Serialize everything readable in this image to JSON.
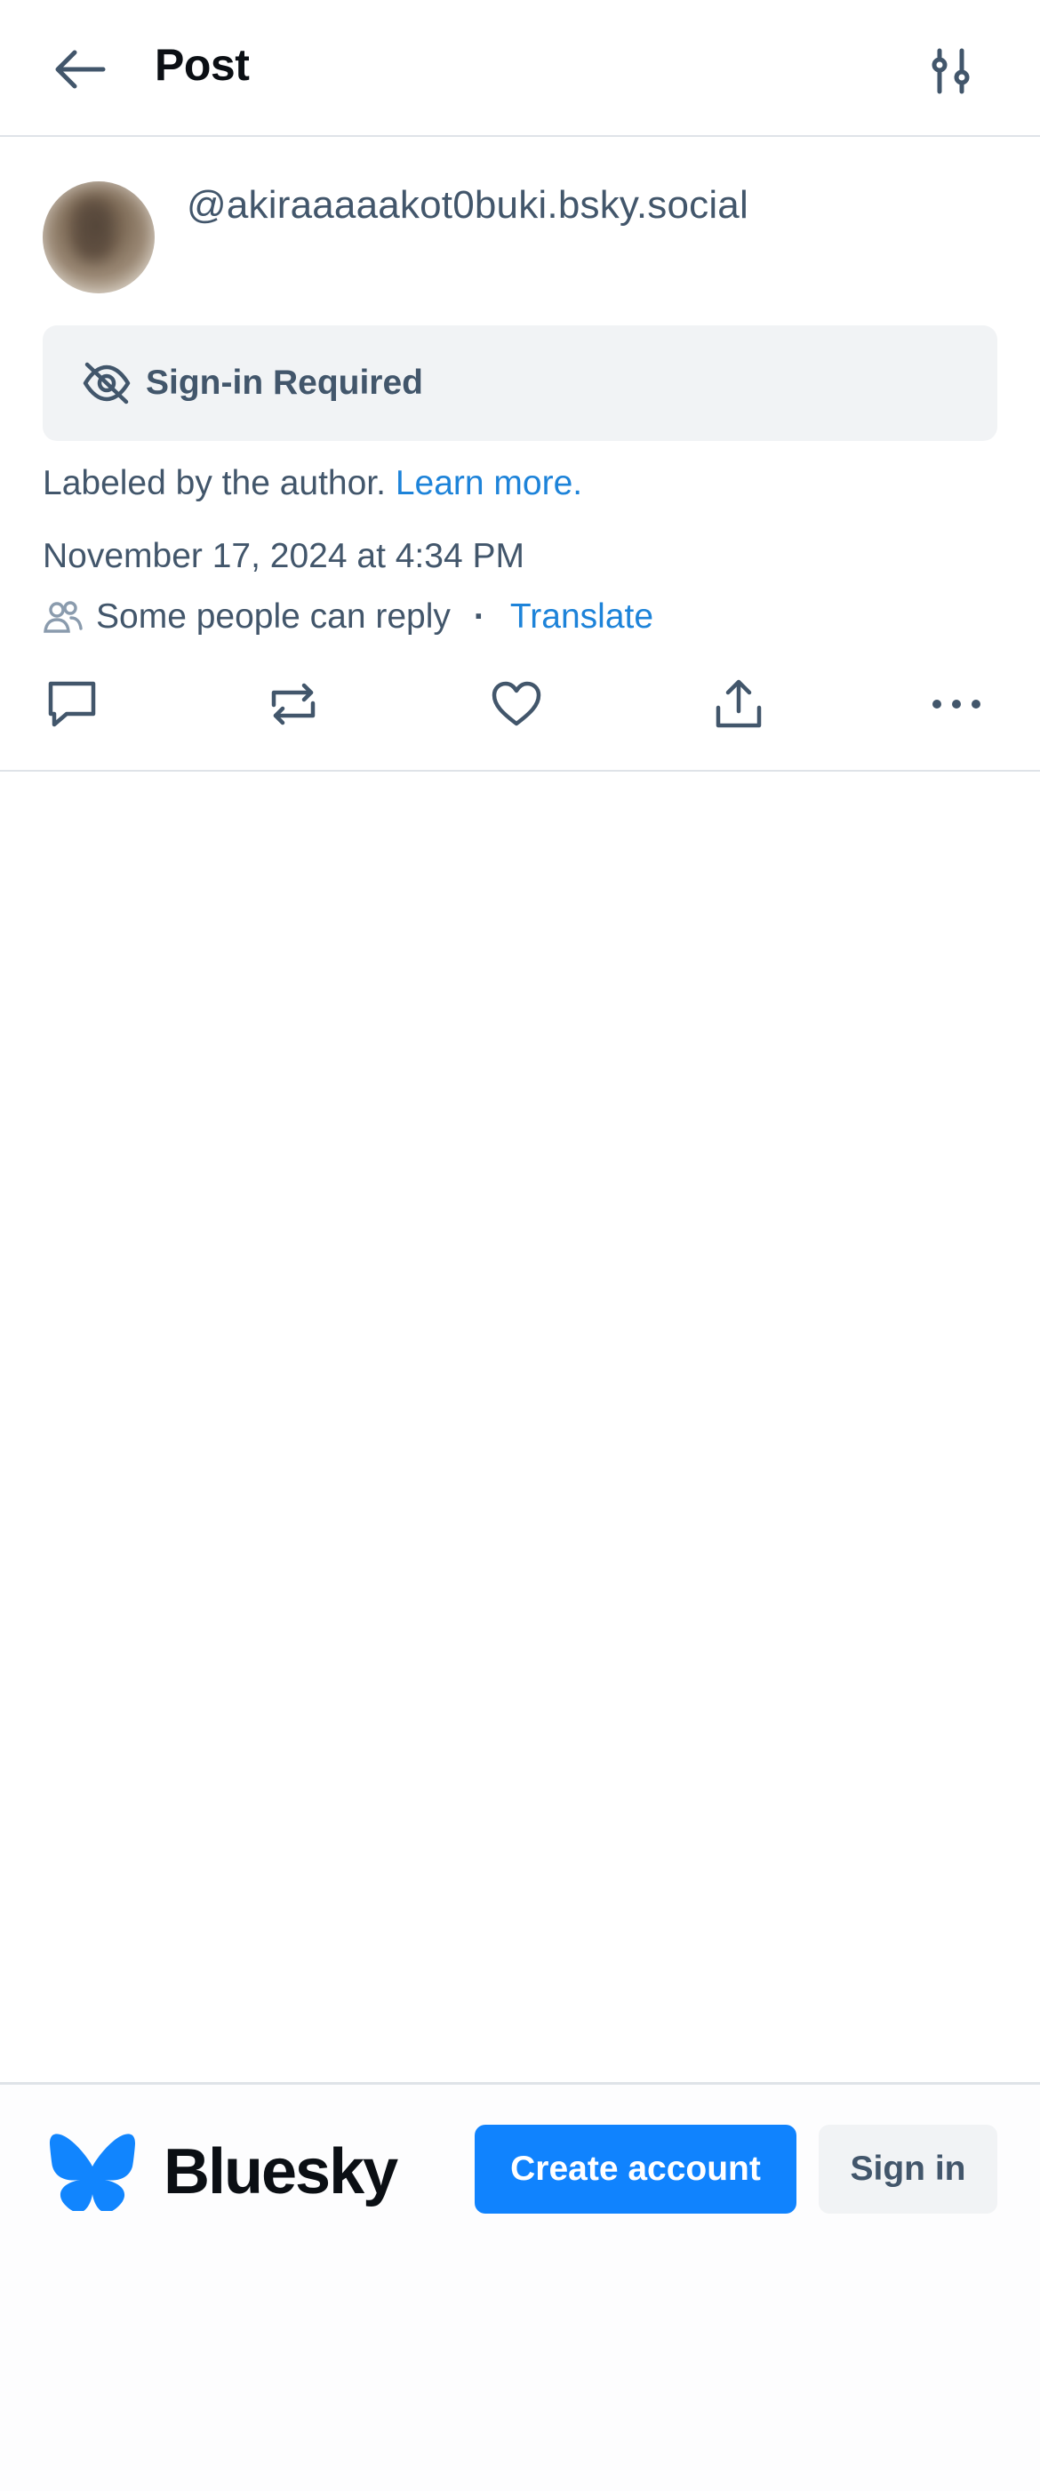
{
  "header": {
    "title": "Post",
    "back_icon": "arrow-left-icon",
    "filter_icon": "sliders-icon"
  },
  "post": {
    "handle": "@akiraaaaakot0buki.bsky.social",
    "content_warning": {
      "icon": "eye-slash-icon",
      "label": "Sign-in Required"
    },
    "label_note": {
      "text": "Labeled by the author.",
      "link": "Learn more."
    },
    "timestamp": "November 17, 2024 at 4:34 PM",
    "reply_setting": {
      "icon": "people-icon",
      "text": "Some people can reply",
      "separator": "·",
      "translate": "Translate"
    },
    "actions": [
      {
        "name": "reply",
        "icon": "comment-icon"
      },
      {
        "name": "repost",
        "icon": "repost-icon"
      },
      {
        "name": "like",
        "icon": "heart-icon"
      },
      {
        "name": "share",
        "icon": "share-icon"
      },
      {
        "name": "more",
        "icon": "ellipsis-icon"
      }
    ]
  },
  "footer": {
    "brand": "Bluesky",
    "create_account": "Create account",
    "sign_in": "Sign in"
  },
  "colors": {
    "accent": "#1083fe",
    "link": "#1d83d9",
    "muted_text": "#42566b",
    "panel_bg": "#f1f3f5",
    "divider": "#dfe3e8"
  }
}
